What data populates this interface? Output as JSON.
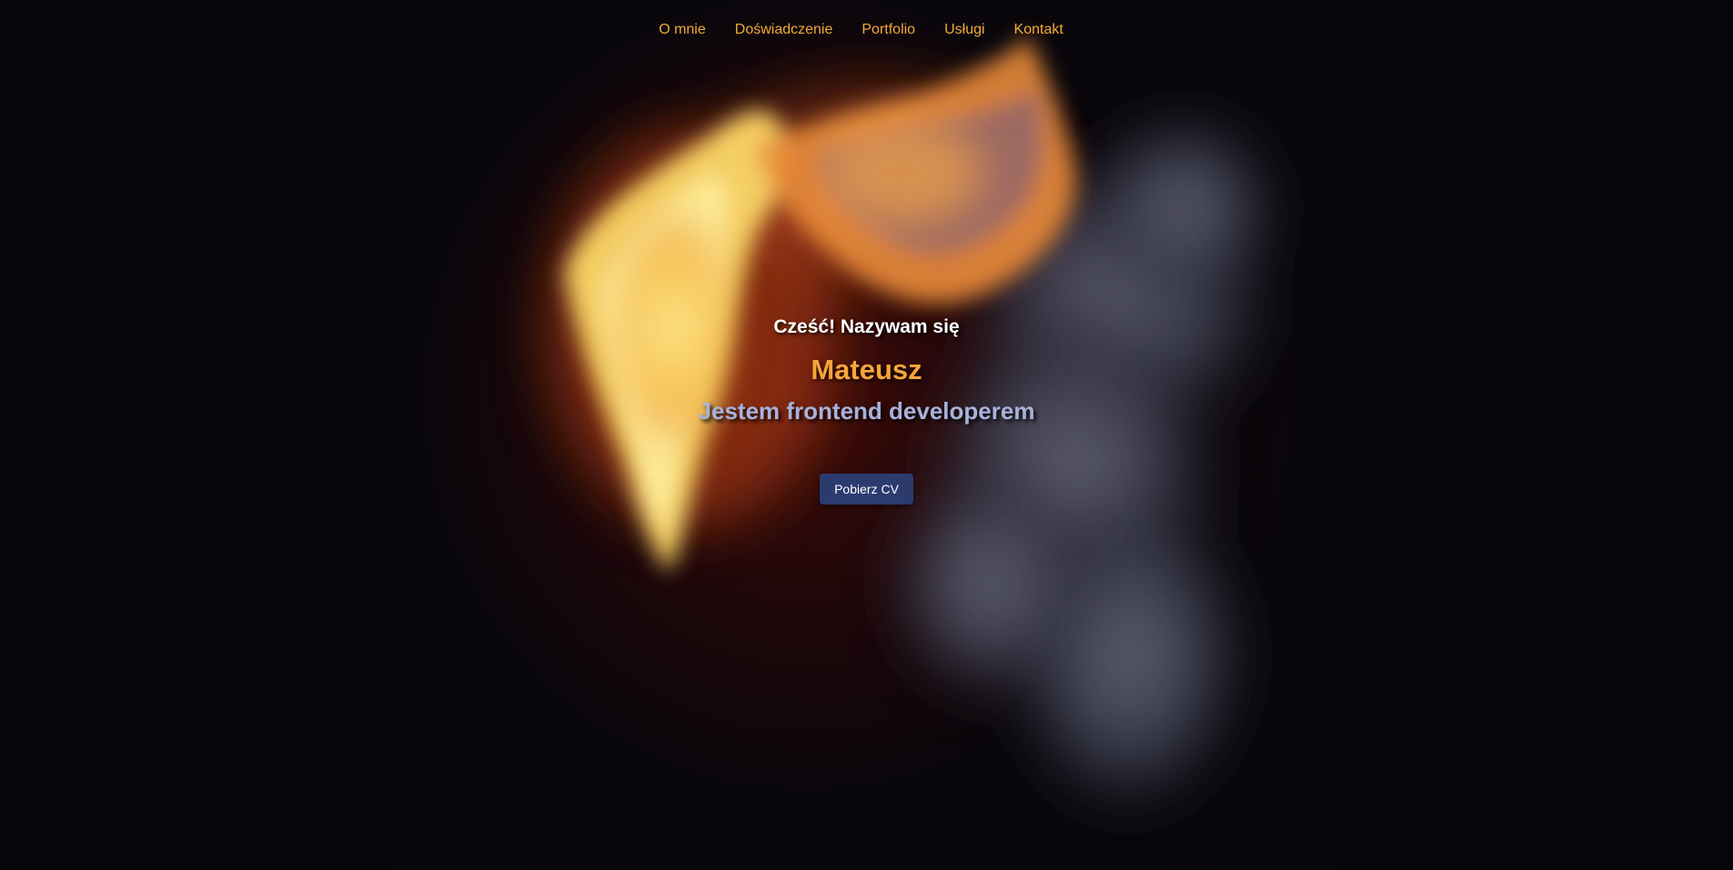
{
  "nav": {
    "items": [
      {
        "label": "O mnie"
      },
      {
        "label": "Doświadczenie"
      },
      {
        "label": "Portfolio"
      },
      {
        "label": "Usługi"
      },
      {
        "label": "Kontakt"
      }
    ]
  },
  "hero": {
    "greeting": "Cześć! Nazywam się",
    "name": "Mateusz",
    "role": "Jestem frontend developerem",
    "cta_label": "Pobierz CV"
  },
  "colors": {
    "accent": "#f7a53a",
    "nav_link": "#f2a93b",
    "role_text": "#a8b1db",
    "button_bg": "#2c3b6e",
    "background": "#06060a"
  }
}
